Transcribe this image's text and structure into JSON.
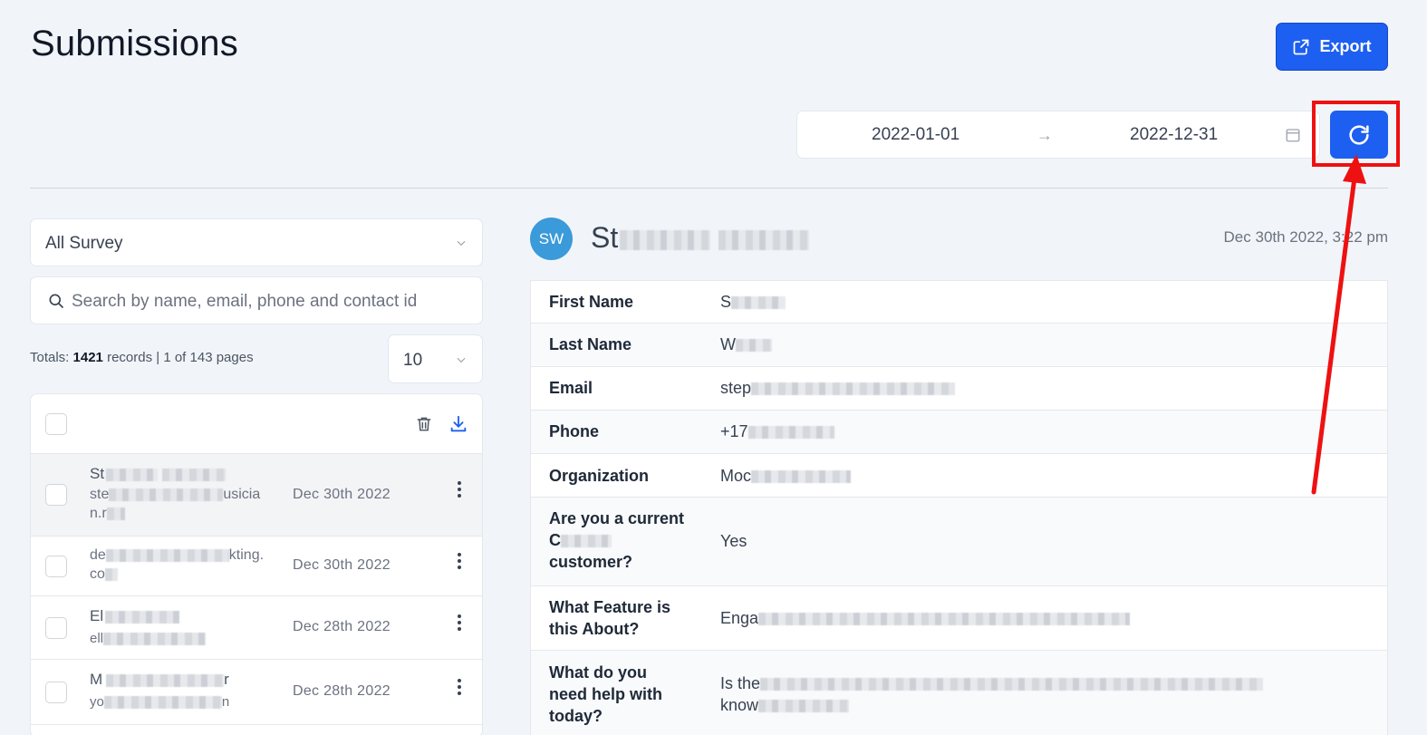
{
  "header": {
    "title": "Submissions",
    "export_label": "Export"
  },
  "date_range": {
    "start": "2022-01-01",
    "arrow": "→",
    "end": "2022-12-31"
  },
  "filters": {
    "survey_select": "All Survey",
    "search_placeholder": "Search by name, email, phone and contact id",
    "totals_prefix": "Totals: ",
    "totals_count": "1421",
    "totals_suffix": " records | 1 of 143 pages",
    "per_page": "10"
  },
  "list": {
    "rows": [
      {
        "name": "St",
        "email": "ste",
        "email_tail": "usicia",
        "email_line2": "n.r",
        "date": "Dec 30th 2022"
      },
      {
        "name": "",
        "email": "de",
        "email_tail": "kting.",
        "email_line2": "co",
        "date": "Dec 30th 2022"
      },
      {
        "name": "El",
        "email": "ell",
        "email_tail": "",
        "email_line2": "",
        "date": "Dec 28th 2022"
      },
      {
        "name": "M",
        "name_tail": "r",
        "email": "yo",
        "email_tail": "n",
        "email_line2": "",
        "date": "Dec 28th 2022"
      }
    ]
  },
  "contact": {
    "initials": "SW",
    "name_prefix": "St",
    "submitted_at": "Dec 30th 2022, 3:22 pm",
    "fields": [
      {
        "label": "First Name",
        "value": "S"
      },
      {
        "label": "Last Name",
        "value": "W"
      },
      {
        "label": "Email",
        "value": "step"
      },
      {
        "label": "Phone",
        "value": "+17"
      },
      {
        "label": "Organization",
        "value": "Moc"
      },
      {
        "label_line1": "Are you a current",
        "label_line2": "C",
        "label_line3": "customer?",
        "value": "Yes"
      },
      {
        "label_line1": "What Feature is",
        "label_line2": "this About?",
        "value": "Enga"
      },
      {
        "label_line1": "What do you",
        "label_line2": "need help with",
        "label_line3": "today?",
        "value": "Is the",
        "value_line2": "know"
      }
    ]
  },
  "colors": {
    "primary": "#1d5ff0",
    "highlight": "#ee1111",
    "avatar": "#3b9ad9"
  }
}
